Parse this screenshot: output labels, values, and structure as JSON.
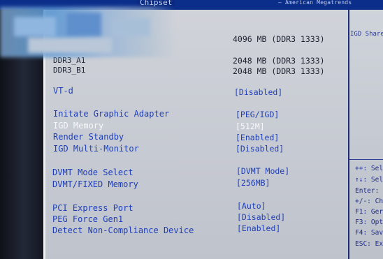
{
  "header": {
    "tab": "Chipset",
    "copyright": "— American Megatrends"
  },
  "memory": {
    "total_value": "4096 MB (DDR3 1333)",
    "rows": [
      {
        "label": "DDR3_A1",
        "value": "2048 MB (DDR3 1333)"
      },
      {
        "label": "DDR3_B1",
        "value": "2048 MB (DDR3 1333)"
      }
    ]
  },
  "settings": {
    "vtd": {
      "label": "VT-d",
      "value": "[Disabled]"
    },
    "initiate_graphic": {
      "label": "Initate Graphic Adapter",
      "value": "[PEG/IGD]"
    },
    "igd_memory": {
      "label": "IGD Memory",
      "value": "[512M]"
    },
    "render_standby": {
      "label": "Render Standby",
      "value": "[Enabled]"
    },
    "igd_multi_monitor": {
      "label": "IGD Multi-Monitor",
      "value": "[Disabled]"
    },
    "dvmt_mode": {
      "label": "DVMT Mode Select",
      "value": "[DVMT Mode]"
    },
    "dvmt_memory": {
      "label": "DVMT/FIXED Memory",
      "value": "[256MB]"
    },
    "pci_express": {
      "label": "PCI Express Port",
      "value": "[Auto]"
    },
    "peg_force": {
      "label": "PEG Force Gen1",
      "value": "[Disabled]"
    },
    "detect_noncompliance": {
      "label": "Detect Non-Compliance Device",
      "value": "[Enabled]"
    }
  },
  "help": {
    "description": "IGD Share",
    "keys": [
      "++: Sel",
      "↑↓: Sel",
      "Enter:",
      "+/-: Ch",
      "F1: Ger",
      "F3: Opt",
      "F4: Sav",
      "ESC: Ex"
    ]
  }
}
